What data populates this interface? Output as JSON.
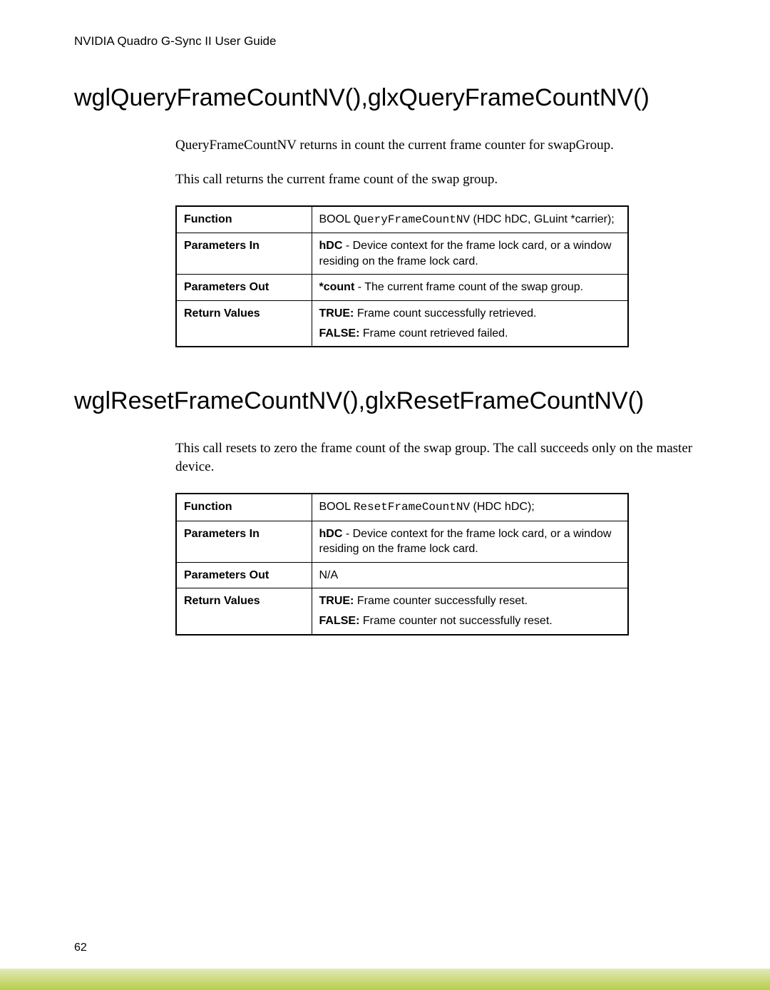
{
  "header": {
    "title": "NVIDIA Quadro G-Sync II User Guide"
  },
  "section1": {
    "heading": "wglQueryFrameCountNV(),glxQueryFrameCountNV()",
    "para1": "QueryFrameCountNV returns in count the current frame counter for swapGroup.",
    "para2": "This call returns the current frame count of the swap group.",
    "table": {
      "row1": {
        "label": "Function",
        "pre": "BOOL ",
        "mono": "QueryFrameCountNV",
        "post": " (HDC hDC, GLuint *carrier);"
      },
      "row2": {
        "label": "Parameters In",
        "bold": "hDC",
        "rest": " - Device context for the frame lock card, or a window residing on the frame lock card."
      },
      "row3": {
        "label": "Parameters Out",
        "bold": "*count",
        "rest": " - The current frame count of the swap group."
      },
      "row4": {
        "label": "Return Values",
        "l1b": "TRUE:",
        "l1": " Frame count successfully retrieved.",
        "l2b": "FALSE:",
        "l2": " Frame count retrieved failed."
      }
    }
  },
  "section2": {
    "heading": "wglResetFrameCountNV(),glxResetFrameCountNV()",
    "para1": "This call resets to zero the frame count of the swap group. The call succeeds only on the master device.",
    "table": {
      "row1": {
        "label": "Function",
        "pre": "BOOL ",
        "mono": "ResetFrameCountNV",
        "post": " (HDC hDC);"
      },
      "row2": {
        "label": "Parameters In",
        "bold": "hDC",
        "rest": " - Device context for the frame lock card, or a window residing on the frame lock card."
      },
      "row3": {
        "label": "Parameters Out",
        "value": "N/A"
      },
      "row4": {
        "label": "Return Values",
        "l1b": "TRUE:",
        "l1": " Frame counter successfully reset.",
        "l2b": "FALSE:",
        "l2": " Frame counter not successfully reset."
      }
    }
  },
  "footer": {
    "pageNumber": "62"
  }
}
